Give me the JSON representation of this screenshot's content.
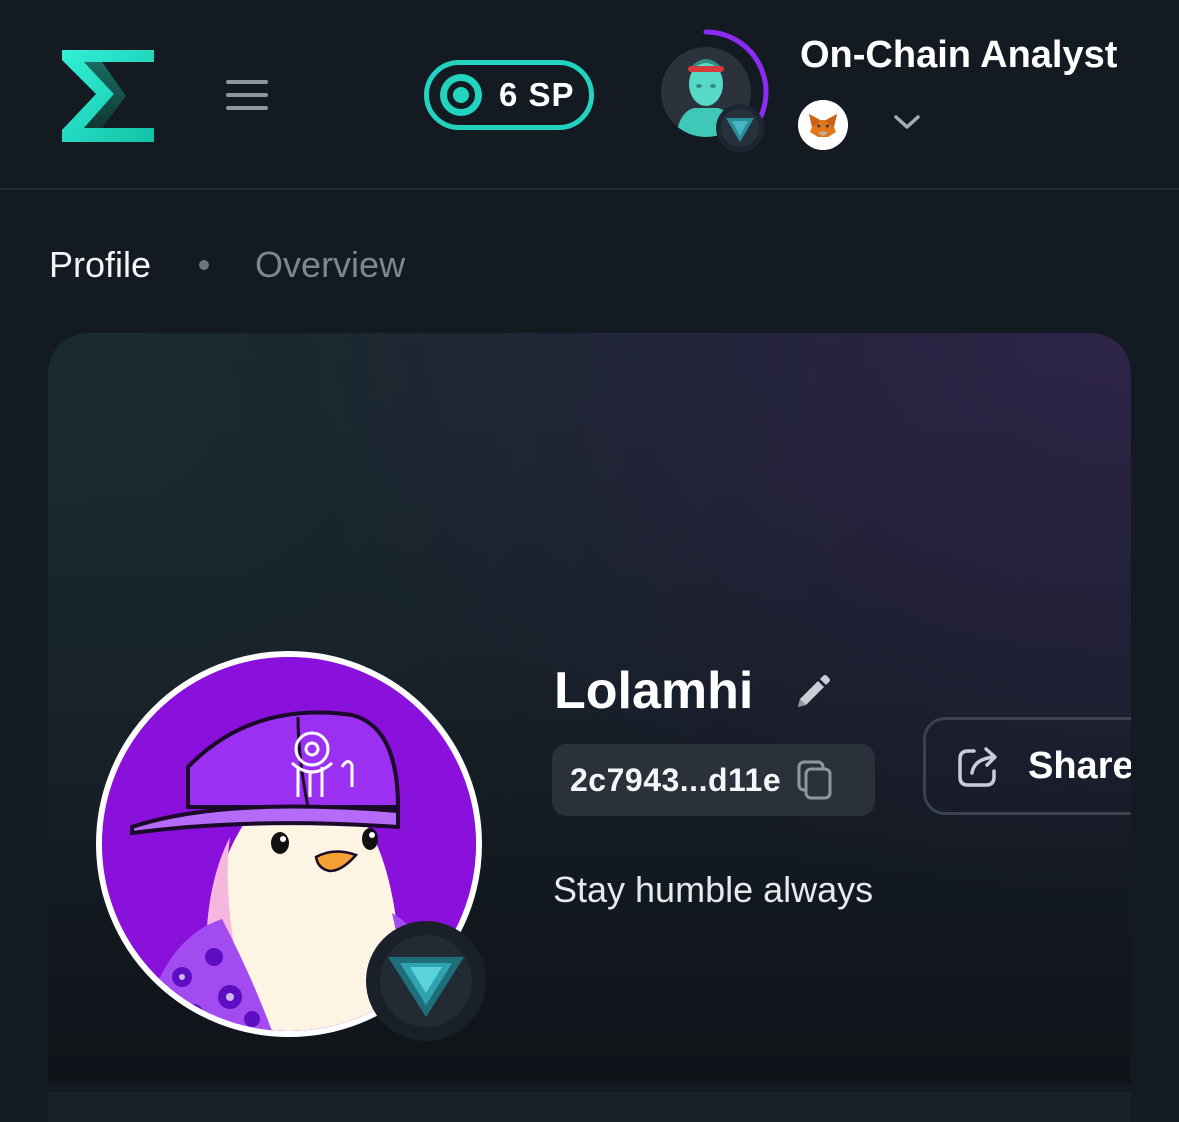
{
  "header": {
    "points_label": "6 SP",
    "user_name": "On-Chain Analyst",
    "level_progress": 0.38
  },
  "breadcrumb": {
    "current": "Profile",
    "next": "Overview"
  },
  "profile": {
    "name": "Lolamhi",
    "address": "2c7943...d11e",
    "share_label": "Share",
    "bio": "Stay humble always"
  },
  "colors": {
    "brand_teal": "#22d3bf",
    "level_ring": "#8b2cf5",
    "avatar_bg": "#8a10dc",
    "background": "#141a22"
  },
  "icons": {
    "logo": "sigma-logo",
    "menu": "hamburger-menu-icon",
    "points": "sp-ring-icon",
    "wallet": "metamask-fox-icon",
    "dropdown": "chevron-down-icon",
    "edit": "pencil-icon",
    "copy": "copy-icon",
    "share": "share-icon",
    "badge": "triangle-rank-badge"
  }
}
